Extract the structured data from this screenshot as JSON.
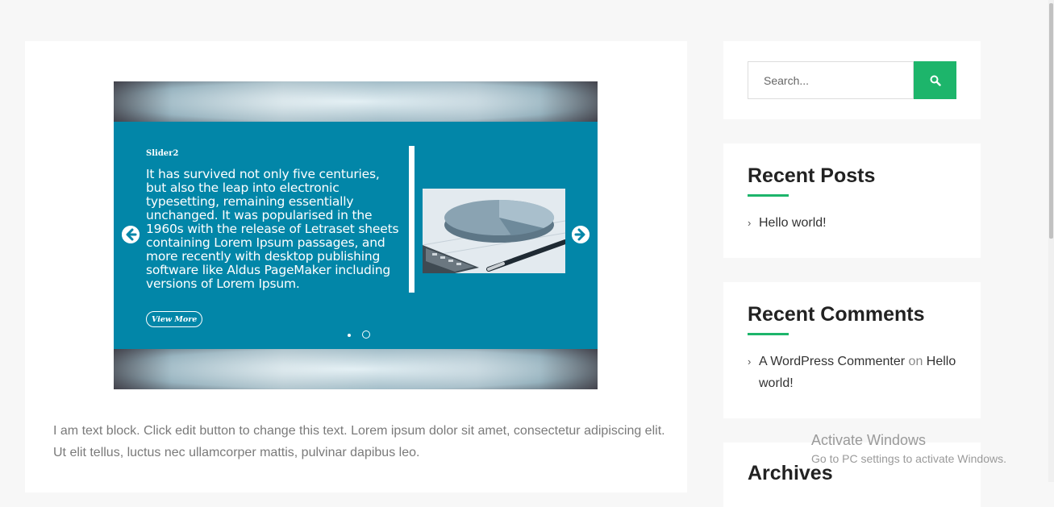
{
  "slider": {
    "kicker": "Slider2",
    "body": "It has survived not only five centuries, but also the leap into electronic typesetting, remaining essentially unchanged. It was popularised in the 1960s with the release of Letraset sheets containing Lorem Ipsum passages, and more recently with desktop publishing software like Aldus PageMaker including versions of Lorem Ipsum.",
    "button_label": "View More",
    "panel_color": "#0286a8",
    "prev_icon": "arrow-left-circle-icon",
    "next_icon": "arrow-right-circle-icon"
  },
  "content": {
    "text_block": "I am text block. Click edit button to change this text. Lorem ipsum dolor sit amet, consectetur adipiscing elit. Ut elit tellus, luctus nec ullamcorper mattis, pulvinar dapibus leo."
  },
  "sidebar": {
    "search": {
      "placeholder": "Search...",
      "button_icon": "search-icon"
    },
    "recent_posts": {
      "title": "Recent Posts",
      "items": [
        {
          "label": "Hello world!"
        }
      ]
    },
    "recent_comments": {
      "title": "Recent Comments",
      "items": [
        {
          "author": "A WordPress Commenter",
          "connector": "on",
          "post": "Hello world!"
        }
      ]
    },
    "archives": {
      "title": "Archives"
    }
  },
  "watermark": {
    "title": "Activate Windows",
    "subtitle": "Go to PC settings to activate Windows."
  },
  "colors": {
    "accent": "#1db56b",
    "slide": "#0286a8"
  }
}
